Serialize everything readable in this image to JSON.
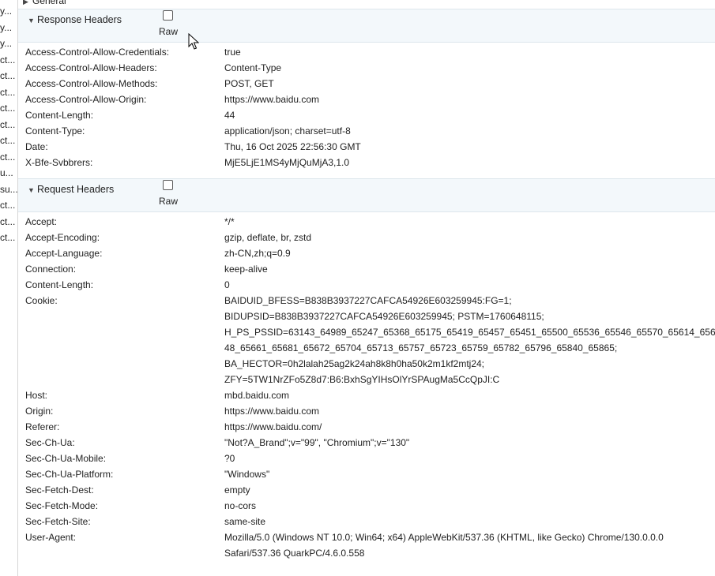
{
  "left_list": [
    "y...",
    "y...",
    "y...",
    "ct...",
    "ct...",
    "ct...",
    "ct...",
    "ct...",
    "ct...",
    "ct...",
    "u...",
    "su...",
    "ct...",
    "ct...",
    "ct..."
  ],
  "general": {
    "label": "General"
  },
  "response": {
    "title": "Response Headers",
    "raw_label": "Raw",
    "rows": [
      {
        "k": "Access-Control-Allow-Credentials:",
        "v": [
          "true"
        ]
      },
      {
        "k": "Access-Control-Allow-Headers:",
        "v": [
          "Content-Type"
        ]
      },
      {
        "k": "Access-Control-Allow-Methods:",
        "v": [
          "POST, GET"
        ]
      },
      {
        "k": "Access-Control-Allow-Origin:",
        "v": [
          "https://www.baidu.com"
        ]
      },
      {
        "k": "Content-Length:",
        "v": [
          "44"
        ]
      },
      {
        "k": "Content-Type:",
        "v": [
          "application/json; charset=utf-8"
        ]
      },
      {
        "k": "Date:",
        "v": [
          "Thu, 16 Oct 2025 22:56:30 GMT"
        ]
      },
      {
        "k": "X-Bfe-Svbbrers:",
        "v": [
          "MjE5LjE1MS4yMjQuMjA3,1.0"
        ]
      }
    ]
  },
  "request": {
    "title": "Request Headers",
    "raw_label": "Raw",
    "rows": [
      {
        "k": "Accept:",
        "v": [
          "*/*"
        ]
      },
      {
        "k": "Accept-Encoding:",
        "v": [
          "gzip, deflate, br, zstd"
        ]
      },
      {
        "k": "Accept-Language:",
        "v": [
          "zh-CN,zh;q=0.9"
        ]
      },
      {
        "k": "Connection:",
        "v": [
          "keep-alive"
        ]
      },
      {
        "k": "Content-Length:",
        "v": [
          "0"
        ]
      },
      {
        "k": "Cookie:",
        "v": [
          "BAIDUID_BFESS=B838B3937227CAFCA54926E603259945:FG=1;",
          "BIDUPSID=B838B3937227CAFCA54926E603259945; PSTM=1760648115;",
          "H_PS_PSSID=63143_64989_65247_65368_65175_65419_65457_65451_65500_65536_65546_65570_65614_656",
          "48_65661_65681_65672_65704_65713_65757_65723_65759_65782_65796_65840_65865;",
          "BA_HECTOR=0h2lalah25ag2k24ah8k8h0ha50k2m1kf2mtj24;",
          "ZFY=5TW1NrZFo5Z8d7:B6:BxhSgYIHsOlYrSPAugMa5CcQpJI:C"
        ]
      },
      {
        "k": "Host:",
        "v": [
          "mbd.baidu.com"
        ]
      },
      {
        "k": "Origin:",
        "v": [
          "https://www.baidu.com"
        ]
      },
      {
        "k": "Referer:",
        "v": [
          "https://www.baidu.com/"
        ]
      },
      {
        "k": "Sec-Ch-Ua:",
        "v": [
          "\"Not?A_Brand\";v=\"99\", \"Chromium\";v=\"130\""
        ]
      },
      {
        "k": "Sec-Ch-Ua-Mobile:",
        "v": [
          "?0"
        ]
      },
      {
        "k": "Sec-Ch-Ua-Platform:",
        "v": [
          "\"Windows\""
        ]
      },
      {
        "k": "Sec-Fetch-Dest:",
        "v": [
          "empty"
        ]
      },
      {
        "k": "Sec-Fetch-Mode:",
        "v": [
          "no-cors"
        ]
      },
      {
        "k": "Sec-Fetch-Site:",
        "v": [
          "same-site"
        ]
      },
      {
        "k": "User-Agent:",
        "v": [
          "Mozilla/5.0 (Windows NT 10.0; Win64; x64) AppleWebKit/537.36 (KHTML, like Gecko) Chrome/130.0.0.0",
          "Safari/537.36 QuarkPC/4.6.0.558"
        ]
      }
    ]
  }
}
